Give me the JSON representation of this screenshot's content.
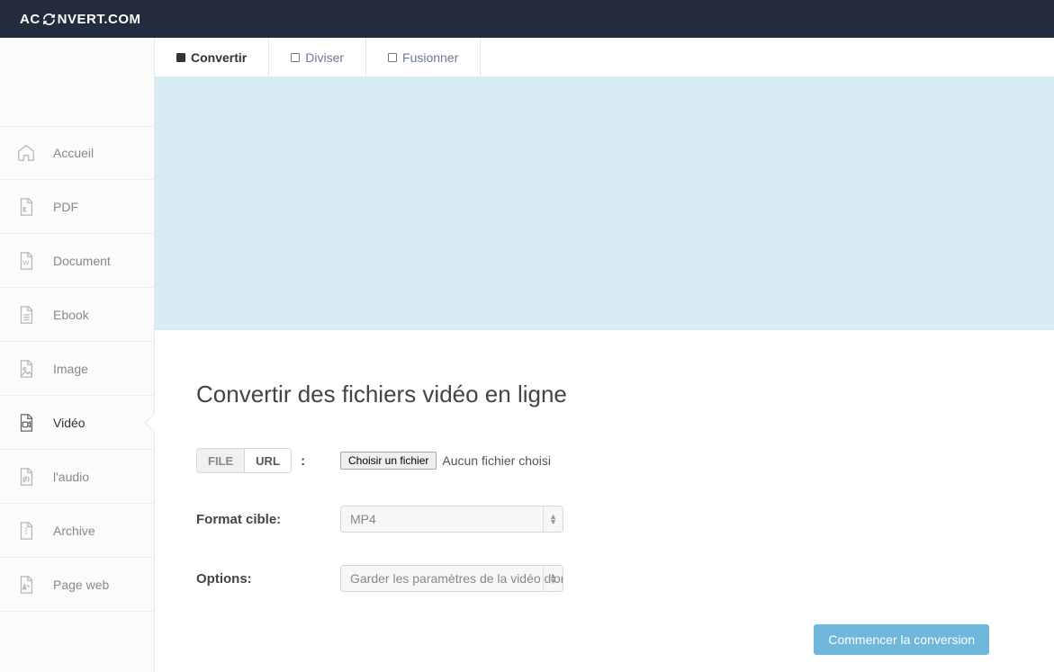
{
  "brand": {
    "prefix": "AC",
    "suffix": "NVERT.COM"
  },
  "sidebar": {
    "items": [
      {
        "label": "Accueil",
        "icon": "home-icon",
        "active": false
      },
      {
        "label": "PDF",
        "icon": "pdf-icon",
        "active": false
      },
      {
        "label": "Document",
        "icon": "doc-icon",
        "active": false
      },
      {
        "label": "Ebook",
        "icon": "ebook-icon",
        "active": false
      },
      {
        "label": "Image",
        "icon": "image-icon",
        "active": false
      },
      {
        "label": "Vidéo",
        "icon": "video-icon",
        "active": true
      },
      {
        "label": "l'audio",
        "icon": "audio-icon",
        "active": false
      },
      {
        "label": "Archive",
        "icon": "archive-icon",
        "active": false
      },
      {
        "label": "Page web",
        "icon": "web-icon",
        "active": false
      }
    ]
  },
  "tabs": [
    {
      "label": "Convertir",
      "active": true
    },
    {
      "label": "Diviser",
      "active": false
    },
    {
      "label": "Fusionner",
      "active": false
    }
  ],
  "page": {
    "title": "Convertir des fichiers vidéo en ligne",
    "source_tabs": {
      "file": "FILE",
      "url": "URL",
      "active": "file",
      "colon": ":"
    },
    "file_button": "Choisir un fichier",
    "file_status": "Aucun fichier choisi",
    "format_label": "Format cible:",
    "format_value": "MP4",
    "options_label": "Options:",
    "options_value": "Garder les paramètres de la vidéo d'origine",
    "submit": "Commencer la conversion"
  }
}
